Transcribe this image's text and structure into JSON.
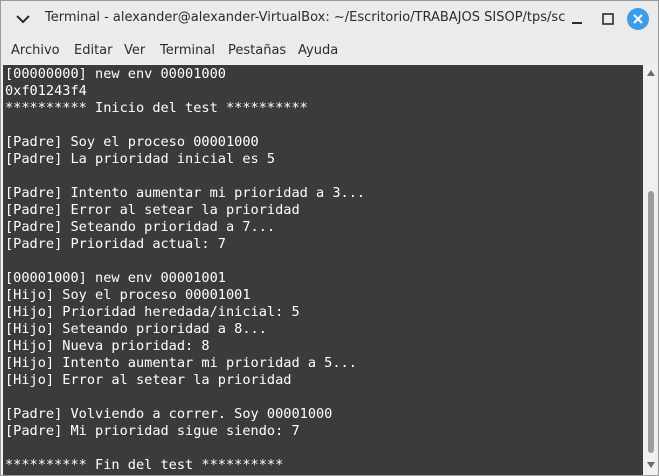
{
  "window": {
    "title": "Terminal - alexander@alexander-VirtualBox: ~/Escritorio/TRABAJOS SISOP/tps/sc"
  },
  "menu": [
    "Archivo",
    "Editar",
    "Ver",
    "Terminal",
    "Pestañas",
    "Ayuda"
  ],
  "terminal": {
    "lines": [
      "[00000000] new env 00001000",
      "0xf01243f4",
      "********** Inicio del test **********",
      "",
      "[Padre] Soy el proceso 00001000",
      "[Padre] La prioridad inicial es 5",
      "",
      "[Padre] Intento aumentar mi prioridad a 3...",
      "[Padre] Error al setear la prioridad",
      "[Padre] Seteando prioridad a 7...",
      "[Padre] Prioridad actual: 7",
      "",
      "[00001000] new env 00001001",
      "[Hijo] Soy el proceso 00001001",
      "[Hijo] Prioridad heredada/inicial: 5",
      "[Hijo] Seteando prioridad a 8...",
      "[Hijo] Nueva prioridad: 8",
      "[Hijo] Intento aumentar mi prioridad a 5...",
      "[Hijo] Error al setear la prioridad",
      "",
      "[Padre] Volviendo a correr. Soy 00001000",
      "[Padre] Mi prioridad sigue siendo: 7",
      "",
      "********** Fin del test **********"
    ]
  },
  "colors": {
    "terminal_bg": "#3b3b3b",
    "terminal_fg": "#ffffff",
    "close_button": "#3d9ce8"
  },
  "icons": {
    "window_menu": "chevron-down-icon",
    "minimize": "minimize-icon",
    "maximize": "maximize-icon",
    "close": "close-icon",
    "scroll_up": "scroll-up-arrow-icon",
    "scroll_down": "scroll-down-arrow-icon"
  }
}
